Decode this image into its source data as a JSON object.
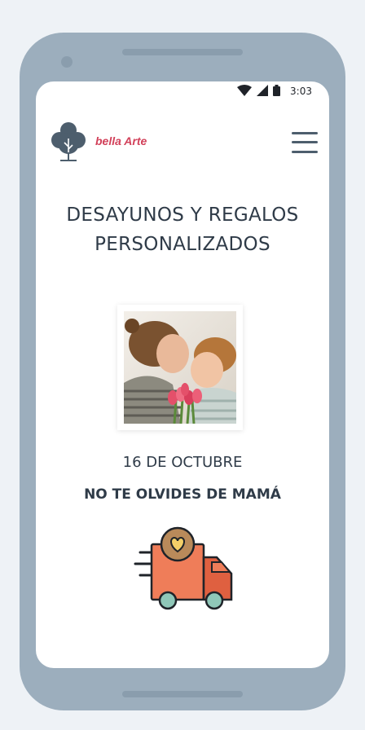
{
  "status_bar": {
    "time": "3:03",
    "icons": [
      "wifi-icon",
      "cellular-signal-icon",
      "battery-icon"
    ]
  },
  "header": {
    "brand": "bella Arte",
    "logo_icon": "tree-icon",
    "menu_icon": "hamburger-menu-icon"
  },
  "hero": {
    "title_line1": "DESAYUNOS Y REGALOS",
    "title_line2": "PERSONALIZADOS"
  },
  "promo": {
    "image": "mother-and-child-with-tulips-photo",
    "date": "16 DE OCTUBRE",
    "tagline": "NO TE OLVIDES DE MAMÁ",
    "delivery_icon": "delivery-truck-heart-icon"
  },
  "colors": {
    "brand": "#d2415a",
    "text": "#2f3b48",
    "phone_frame": "#9caebd",
    "truck": "#ef7d59"
  }
}
